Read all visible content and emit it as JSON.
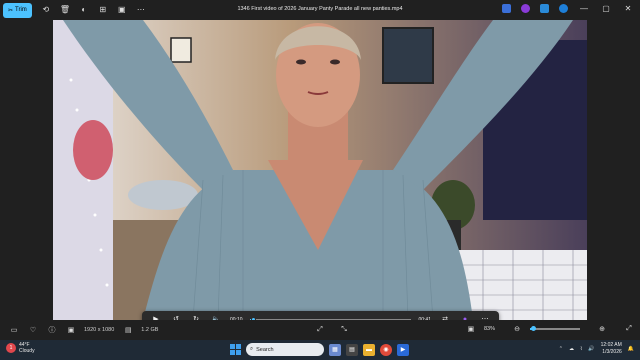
{
  "window": {
    "title": "1346 First video of 2026 January Panty Parade all new panties.mp4",
    "trim_label": "Trim"
  },
  "player": {
    "current_time": "00:10",
    "total_time": "00:41",
    "progress_fraction": 0.02
  },
  "statusbar": {
    "resolution": "1920 x 1080",
    "file_size": "1.2 GB",
    "zoom_value": "83%",
    "zoom_fraction": 0.05
  },
  "taskbar": {
    "weather_temp": "44°F",
    "weather_desc": "Cloudy",
    "weather_badge": "1",
    "search_placeholder": "Search",
    "time": "12:02 AM",
    "date": "1/3/2026"
  }
}
